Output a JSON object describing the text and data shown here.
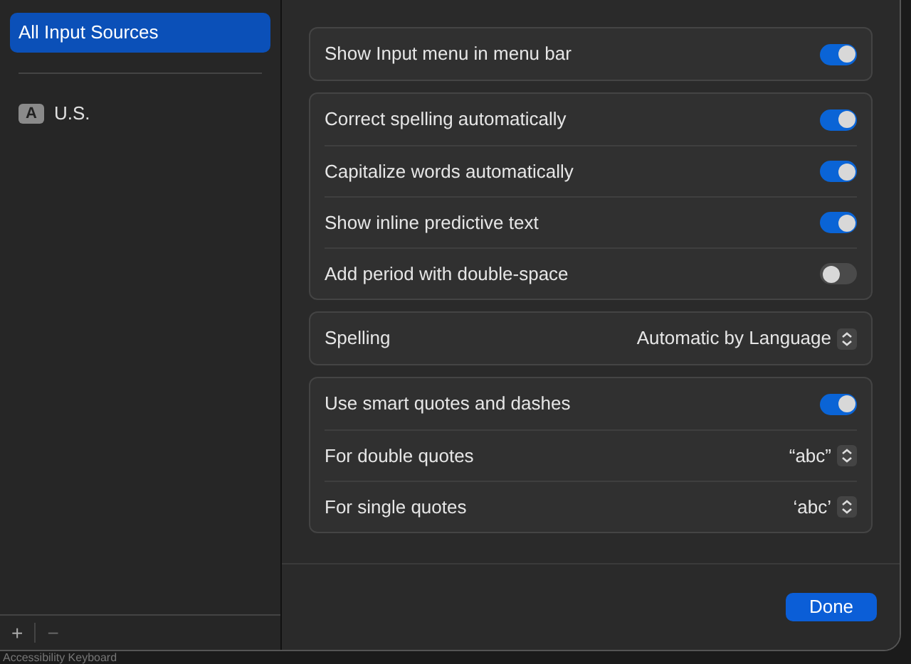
{
  "sidebar": {
    "items": [
      {
        "label": "All Input Sources",
        "selected": true
      },
      {
        "label": "U.S.",
        "badge": "A",
        "selected": false
      }
    ],
    "add": "+",
    "remove": "−"
  },
  "groups": [
    {
      "rows": [
        {
          "kind": "toggle",
          "label": "Show Input menu in menu bar",
          "on": true
        }
      ]
    },
    {
      "rows": [
        {
          "kind": "toggle",
          "label": "Correct spelling automatically",
          "on": true
        },
        {
          "kind": "toggle",
          "label": "Capitalize words automatically",
          "on": true
        },
        {
          "kind": "toggle",
          "label": "Show inline predictive text",
          "on": true
        },
        {
          "kind": "toggle",
          "label": "Add period with double-space",
          "on": false
        }
      ]
    },
    {
      "rows": [
        {
          "kind": "popup",
          "label": "Spelling",
          "value": "Automatic by Language"
        }
      ]
    },
    {
      "rows": [
        {
          "kind": "toggle",
          "label": "Use smart quotes and dashes",
          "on": true
        },
        {
          "kind": "popup",
          "label": "For double quotes",
          "value": "“abc”"
        },
        {
          "kind": "popup",
          "label": "For single quotes",
          "value": "‘abc’"
        }
      ]
    }
  ],
  "done_button": "Done",
  "background_text": "Accessibility Keyboard"
}
